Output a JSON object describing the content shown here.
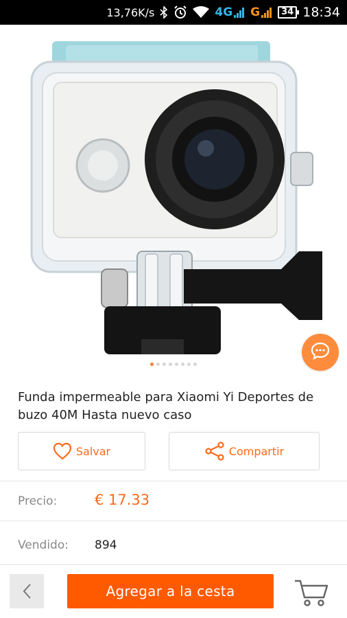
{
  "status_bar": {
    "speed": "13,76K/s",
    "network_1": "4G",
    "network_2": "G",
    "battery": "34",
    "time": "18:34"
  },
  "carousel": {
    "total": 8,
    "active_index": 0
  },
  "product": {
    "title": "Funda impermeable para Xiaomi Yi Deportes de buzo 40M Hasta nuevo caso"
  },
  "actions": {
    "save_label": "Salvar",
    "share_label": "Compartir"
  },
  "details": {
    "price_label": "Precio:",
    "price_value": "€ 17.33",
    "sold_label": "Vendido:",
    "sold_value": "894"
  },
  "bottom_bar": {
    "add_to_cart_label": "Agregar a la cesta"
  },
  "colors": {
    "accent": "#ff5a00",
    "fab": "#ff8c3d"
  },
  "icons": [
    "bluetooth-icon",
    "alarm-icon",
    "wifi-icon",
    "signal-icon",
    "battery-icon",
    "chat-icon",
    "heart-icon",
    "share-icon",
    "chevron-left-icon",
    "cart-icon"
  ]
}
